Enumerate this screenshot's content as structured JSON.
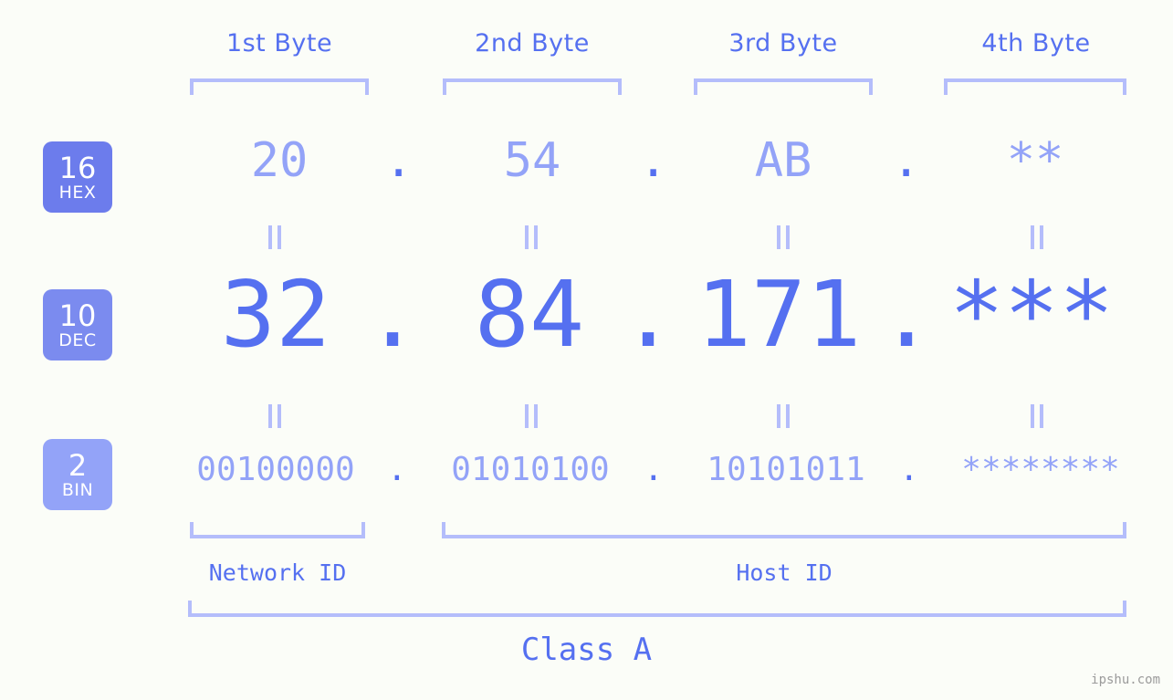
{
  "watermark": "ipshu.com",
  "colors": {
    "background": "#fbfdf8",
    "accent_strong": "#5570f0",
    "accent_light": "#93a3f8",
    "bracket": "#b4bdfb",
    "badge_hex": "#6c7cec",
    "badge_dec": "#7b8bef",
    "badge_bin": "#93a3f8",
    "watermark": "#9b9b9b"
  },
  "byte_headers": [
    {
      "label": "1st Byte"
    },
    {
      "label": "2nd Byte"
    },
    {
      "label": "3rd Byte"
    },
    {
      "label": "4th Byte"
    }
  ],
  "bases": [
    {
      "number": "16",
      "name": "HEX"
    },
    {
      "number": "10",
      "name": "DEC"
    },
    {
      "number": "2",
      "name": "BIN"
    }
  ],
  "rows": {
    "hex": {
      "base_number": "16",
      "base_name": "HEX",
      "values": [
        "20",
        "54",
        "AB",
        "**"
      ],
      "separator": "."
    },
    "dec": {
      "base_number": "10",
      "base_name": "DEC",
      "values": [
        "32",
        "84",
        "171",
        "***"
      ],
      "separator": "."
    },
    "bin": {
      "base_number": "2",
      "base_name": "BIN",
      "values": [
        "00100000",
        "01010100",
        "10101011",
        "********"
      ],
      "separator": "."
    }
  },
  "equivalence_symbol": "=",
  "id_sections": [
    {
      "label": "Network ID"
    },
    {
      "label": "Host ID"
    }
  ],
  "class": {
    "label": "Class A"
  }
}
